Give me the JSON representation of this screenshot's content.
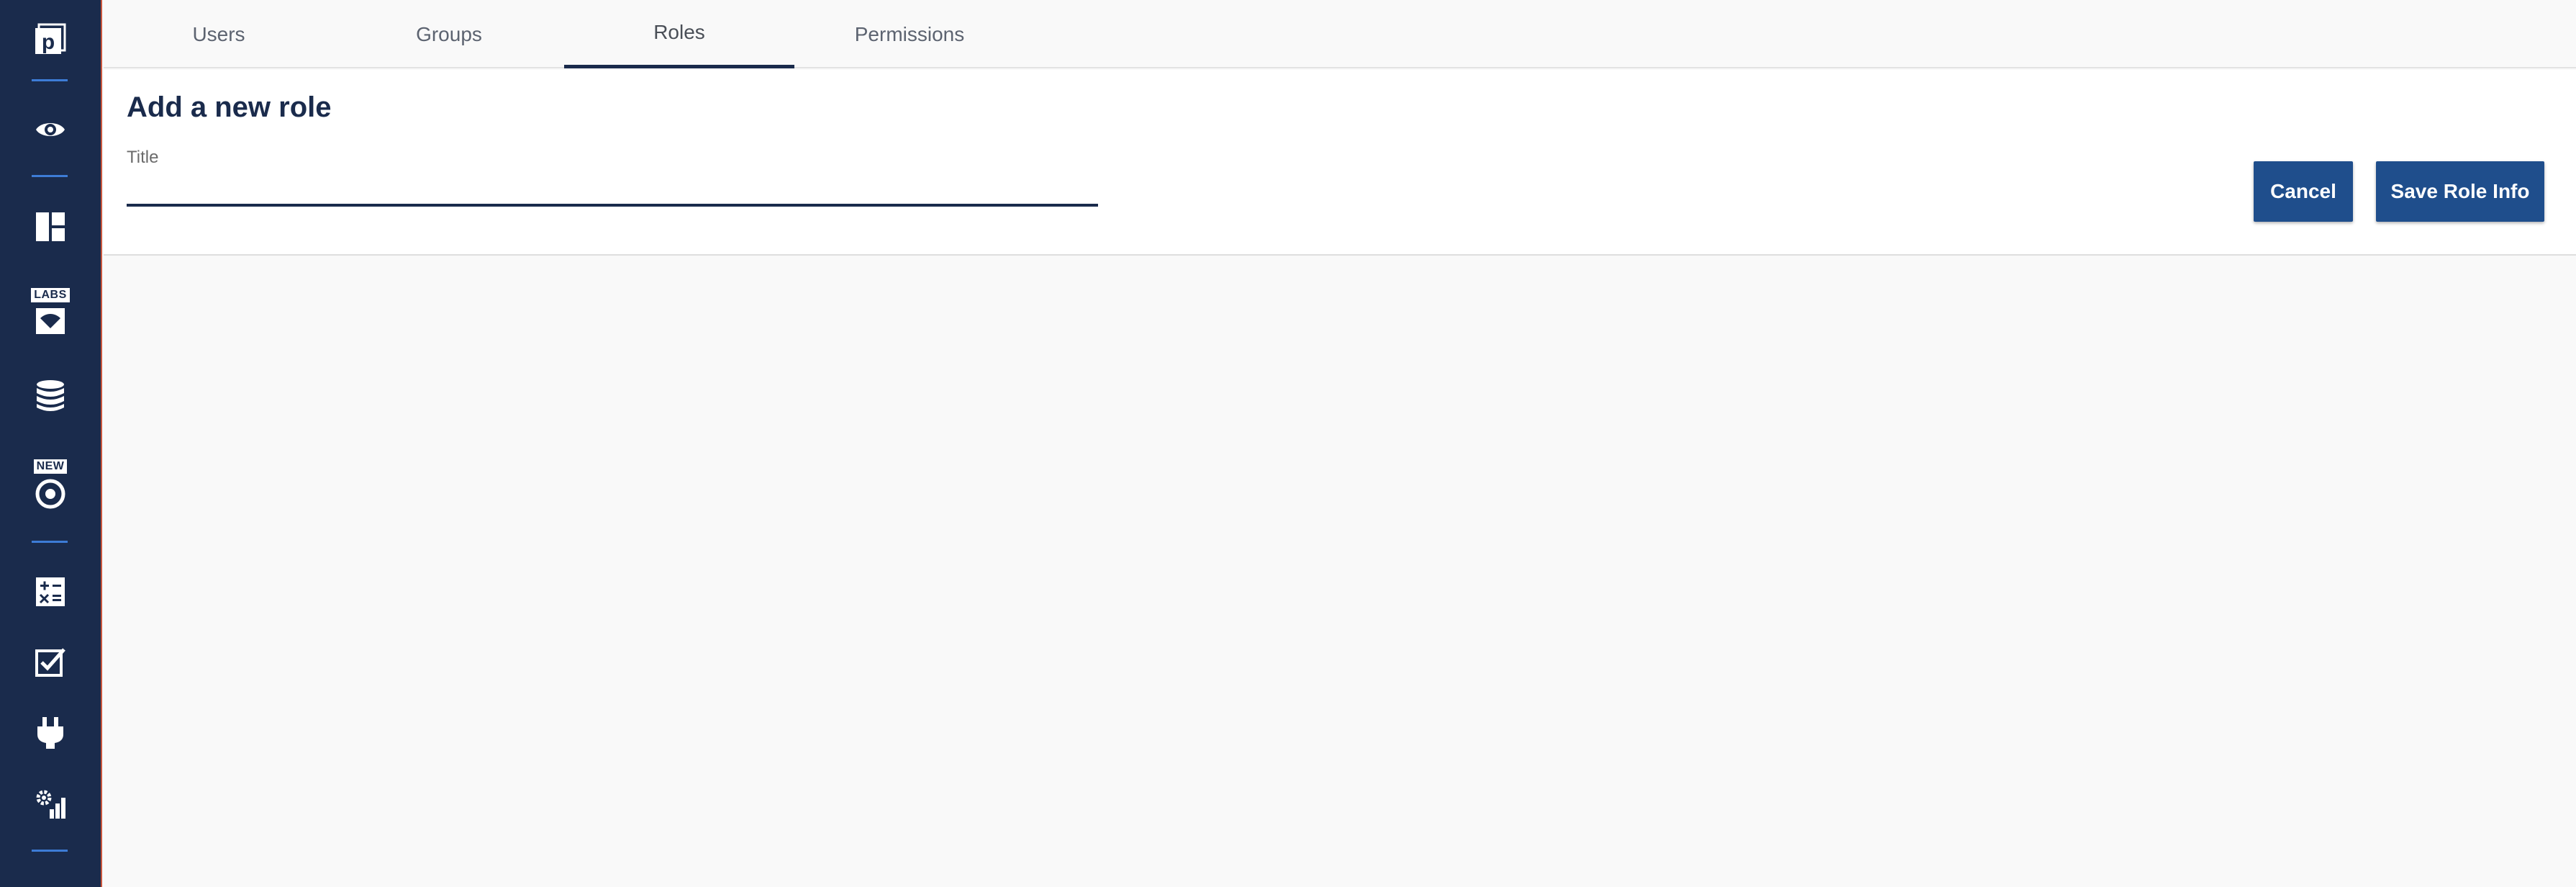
{
  "sidebar": {
    "items": [
      {
        "icon": "logo-icon"
      },
      {
        "icon": "eye-icon"
      },
      {
        "icon": "dashboard-icon"
      },
      {
        "icon": "labs-icon",
        "badge": "LABS"
      },
      {
        "icon": "database-icon"
      },
      {
        "icon": "target-icon",
        "badge": "NEW"
      },
      {
        "icon": "calculator-icon"
      },
      {
        "icon": "checkbox-edit-icon"
      },
      {
        "icon": "plug-icon"
      },
      {
        "icon": "settings-chart-icon"
      }
    ]
  },
  "tabs": [
    {
      "label": "Users"
    },
    {
      "label": "Groups"
    },
    {
      "label": "Roles",
      "active": true
    },
    {
      "label": "Permissions"
    }
  ],
  "form": {
    "title": "Add a new role",
    "title_field_label": "Title",
    "title_field_value": "",
    "cancel_label": "Cancel",
    "save_label": "Save Role Info"
  },
  "colors": {
    "sidebar_bg": "#1a2b4c",
    "accent": "#1f4e8c",
    "divider": "#3d7cd6"
  }
}
